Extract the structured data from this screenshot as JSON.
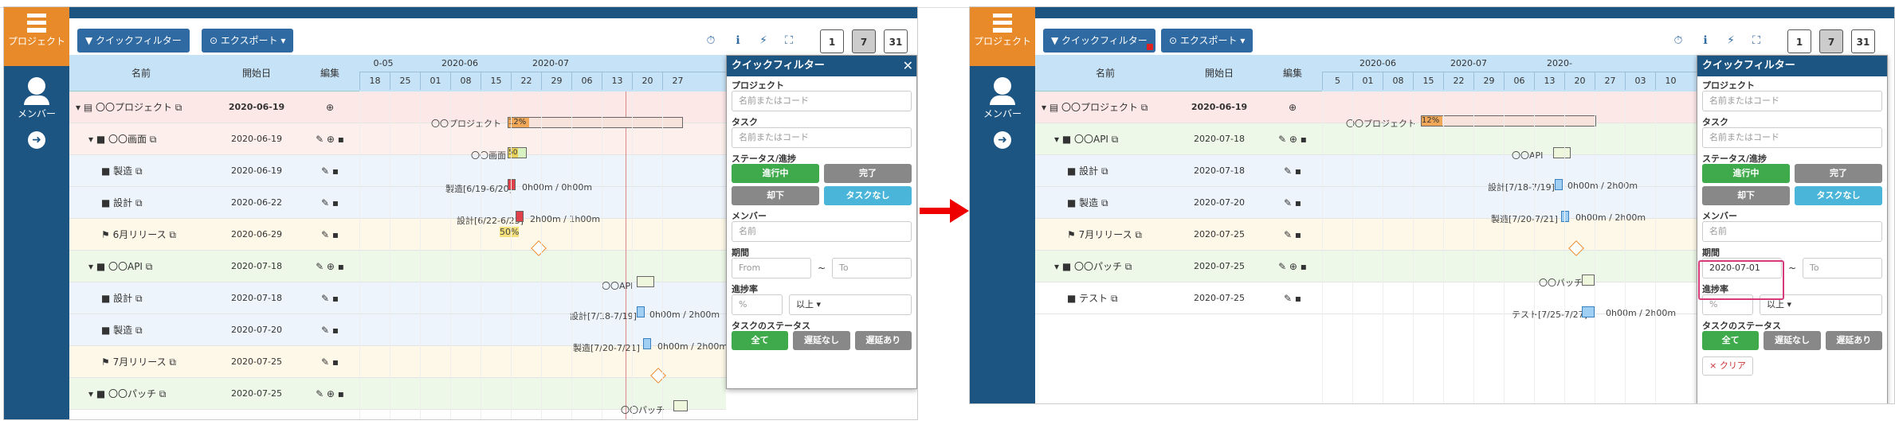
{
  "sidebar": {
    "project_label": "プロジェクト",
    "member_label": "メンバー",
    "arrow_icon": "arrow-right-icon"
  },
  "toolbar": {
    "quick_filter": "▼ クイックフィルター",
    "export": "⊙ エクスポート ▾",
    "cal_day": "1",
    "cal_week": "7",
    "cal_month": "31"
  },
  "columns": {
    "name": "名前",
    "start": "開始日",
    "edit": "編集"
  },
  "left": {
    "months": [
      "0-05",
      "2020-06",
      "2020-07"
    ],
    "days": [
      "18",
      "25",
      "01",
      "08",
      "15",
      "22",
      "29",
      "06",
      "13",
      "20",
      "27"
    ],
    "rows": [
      {
        "name": "▾ ▤ 〇〇プロジェクト ⧉",
        "date": "2020-06-19",
        "edit": "⊕",
        "bg": "#fde8e8"
      },
      {
        "name": "▾ ■ 〇〇画面 ⧉",
        "date": "2020-06-19",
        "edit": "✎ ⊕ ▪",
        "bg": "#fdf0ec"
      },
      {
        "name": "■ 製造 ⧉",
        "date": "2020-06-19",
        "edit": "✎ ▪",
        "bg": "#eef4fb"
      },
      {
        "name": "■ 設計 ⧉",
        "date": "2020-06-22",
        "edit": "✎ ▪",
        "bg": "#eef4fb"
      },
      {
        "name": "⚑ 6月リリース ⧉",
        "date": "2020-06-29",
        "edit": "✎ ▪",
        "bg": "#fdf8e8"
      },
      {
        "name": "▾ ■ 〇〇API ⧉",
        "date": "2020-07-18",
        "edit": "✎ ⊕ ▪",
        "bg": "#eef8e8"
      },
      {
        "name": "■ 設計 ⧉",
        "date": "2020-07-18",
        "edit": "✎ ▪",
        "bg": "#eef4fb"
      },
      {
        "name": "■ 製造 ⧉",
        "date": "2020-07-20",
        "edit": "✎ ▪",
        "bg": "#eef4fb"
      },
      {
        "name": "⚑ 7月リリース ⧉",
        "date": "2020-07-25",
        "edit": "✎ ▪",
        "bg": "#fdf8e8"
      },
      {
        "name": "▾ ■ 〇〇パッチ ⧉",
        "date": "2020-07-25",
        "edit": "✎ ⊕ ▪",
        "bg": "#eef8e8"
      }
    ],
    "gantt_text": {
      "proj": "〇〇プロジェクト",
      "proj_pct": "12%",
      "screen": "〇〇画面",
      "screen_pct": "50",
      "seizo": "製造[6/19-6/20]",
      "seizo_h": "0h00m / 0h00m",
      "sekkei": "設計[6/22-6/23]",
      "sekkei_h": "2h00m / 1h00m",
      "sekkei_pct": "50%",
      "api": "〇〇API",
      "api_sekkei": "設計[7/18-7/19]",
      "api_sekkei_h": "0h00m / 2h00m",
      "api_seizo": "製造[7/20-7/21]",
      "api_seizo_h": "0h00m / 2h00m",
      "patch": "〇〇パッチ"
    }
  },
  "right": {
    "months": [
      "2020-06",
      "2020-07",
      "2020-"
    ],
    "days": [
      "5",
      "01",
      "08",
      "15",
      "22",
      "29",
      "06",
      "13",
      "20",
      "27",
      "03",
      "10"
    ],
    "rows": [
      {
        "name": "▾ ▤ 〇〇プロジェクト ⧉",
        "date": "2020-06-19",
        "edit": "⊕",
        "bg": "#fde8e8"
      },
      {
        "name": "▾ ■ 〇〇API ⧉",
        "date": "2020-07-18",
        "edit": "✎ ⊕ ▪",
        "bg": "#eef8e8"
      },
      {
        "name": "■ 設計 ⧉",
        "date": "2020-07-18",
        "edit": "✎ ▪",
        "bg": "#eef4fb"
      },
      {
        "name": "■ 製造 ⧉",
        "date": "2020-07-20",
        "edit": "✎ ▪",
        "bg": "#eef4fb"
      },
      {
        "name": "⚑ 7月リリース ⧉",
        "date": "2020-07-25",
        "edit": "✎ ▪",
        "bg": "#fdf8e8"
      },
      {
        "name": "▾ ■ 〇〇パッチ ⧉",
        "date": "2020-07-25",
        "edit": "✎ ⊕ ▪",
        "bg": "#eef8e8"
      },
      {
        "name": "■ テスト ⧉",
        "date": "2020-07-25",
        "edit": "✎ ▪",
        "bg": "#fff"
      }
    ],
    "gantt_text": {
      "proj": "〇〇プロジェクト",
      "proj_pct": "12%",
      "api": "〇〇API",
      "api_sekkei": "設計[7/18-7/19]",
      "api_sekkei_h": "0h00m / 2h00m",
      "api_seizo": "製造[7/20-7/21]",
      "api_seizo_h": "0h00m / 2h00m",
      "patch": "〇〇パッチ",
      "test": "テスト[7/25-7/27]",
      "test_h": "0h00m / 2h00m"
    }
  },
  "panel": {
    "title": "クイックフィルター",
    "close": "✕",
    "project_label": "プロジェクト",
    "project_ph": "名前またはコード",
    "task_label": "タスク",
    "task_ph": "名前またはコード",
    "status_label": "ステータス/進捗",
    "in_progress": "進行中",
    "done": "完了",
    "dropped": "却下",
    "no_task": "タスクなし",
    "member_label": "メンバー",
    "member_ph": "名前",
    "period_label": "期間",
    "from_ph": "From",
    "to_ph": "To",
    "tilde": "~",
    "period_from_value": "2020-07-01",
    "progress_label": "進捗率",
    "pct_ph": "%",
    "gte": "以上 ▾",
    "task_status_label": "タスクのステータス",
    "all": "全て",
    "no_delay": "遅延なし",
    "delayed": "遅延あり",
    "clear": "× クリア"
  }
}
